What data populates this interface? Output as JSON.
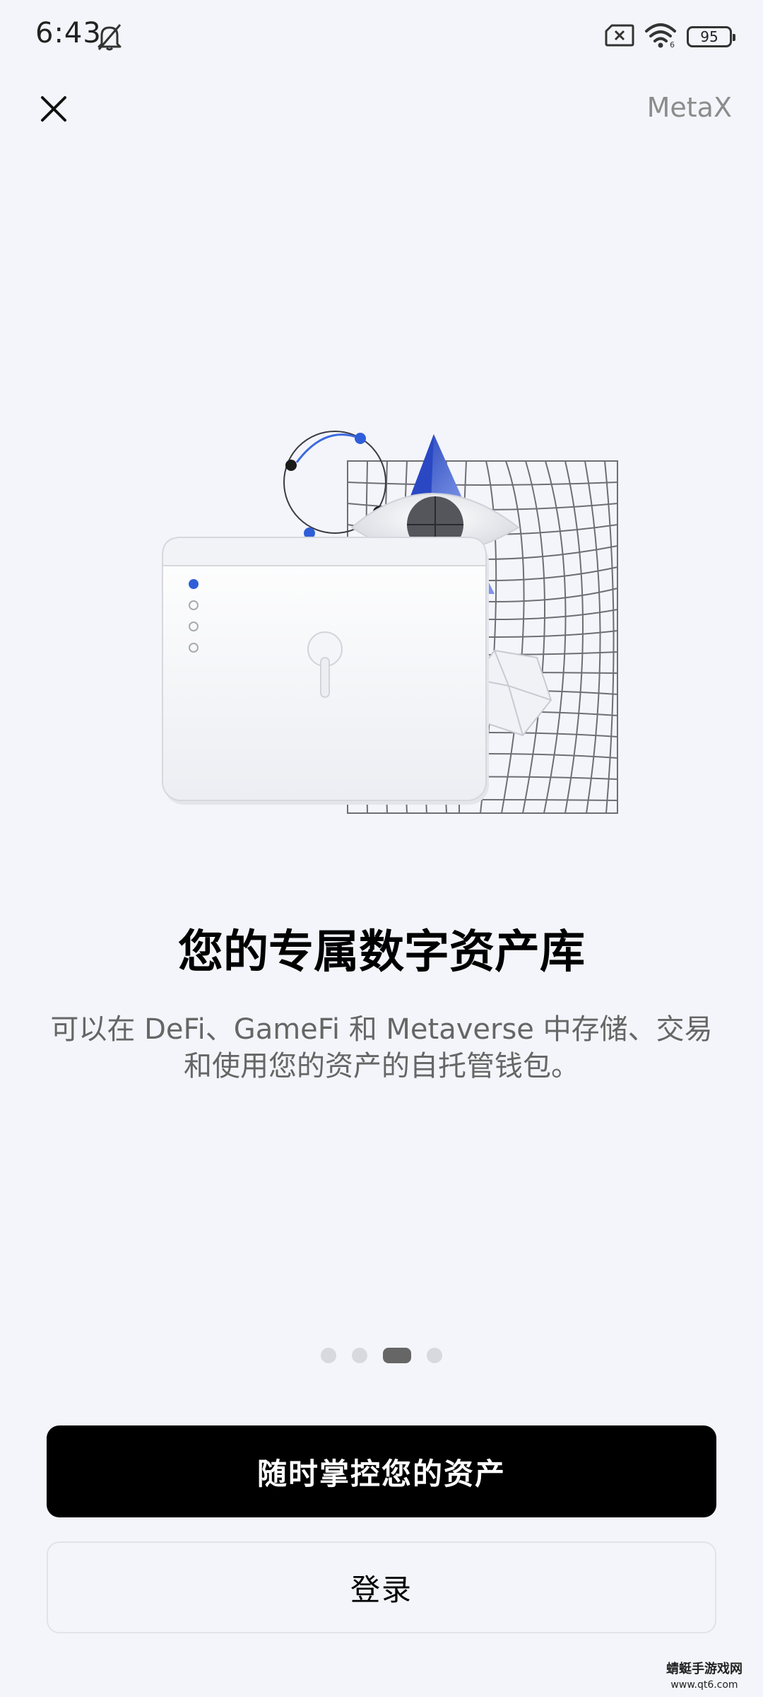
{
  "status_bar": {
    "time": "6:43",
    "battery": "95",
    "icons": [
      "bell-off-icon",
      "sim-error-icon",
      "wifi-icon",
      "battery-icon"
    ]
  },
  "header": {
    "close_icon": "close-icon",
    "brand": "MetaX"
  },
  "onboarding": {
    "title": "您的专属数字资产库",
    "subtitle_line1": "可以在 DeFi、GameFi 和 Metaverse 中存储、交易",
    "subtitle_line2": "和使用您的资产的自托管钱包。",
    "pager": {
      "total": 4,
      "active_index": 2
    }
  },
  "actions": {
    "primary_label": "随时掌控您的资产",
    "secondary_label": "登录"
  },
  "watermark": {
    "line1": "蜻蜓手游戏网",
    "line2": "www.qt6.com"
  },
  "colors": {
    "background": "#f4f5fa",
    "primary_button": "#000000",
    "accent_blue": "#2f5fd8"
  }
}
